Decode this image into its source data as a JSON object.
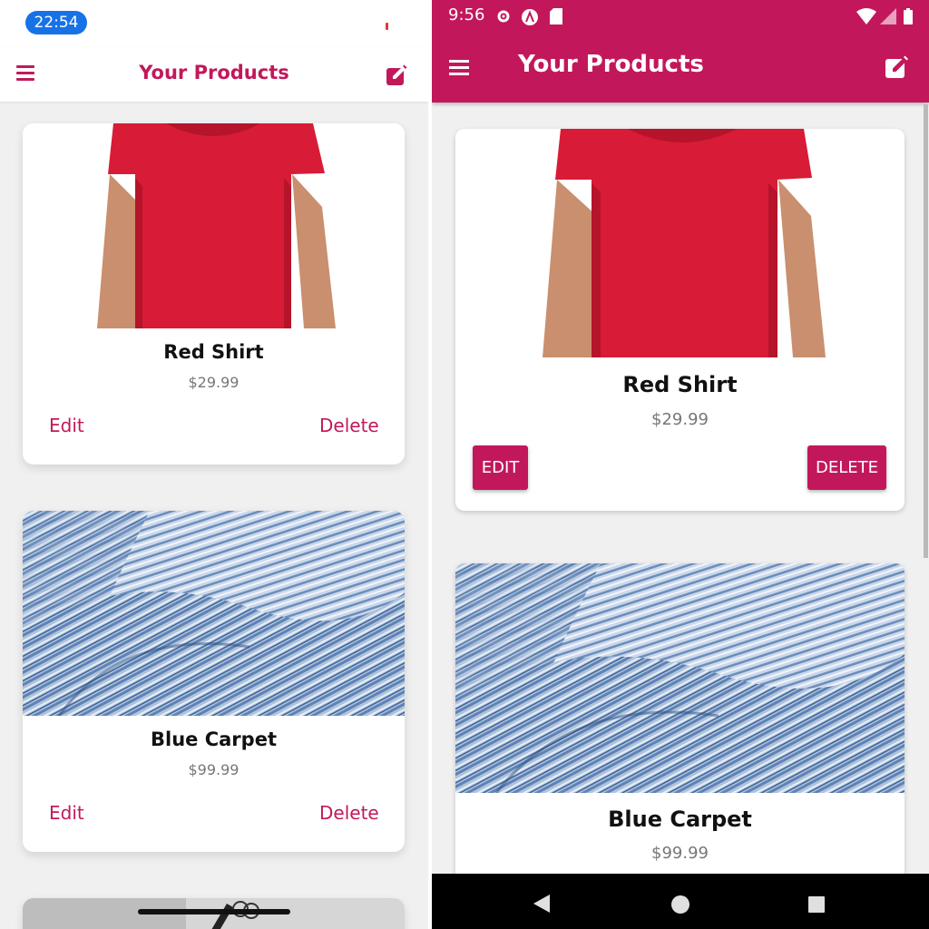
{
  "ios": {
    "status_time": "22:54",
    "title": "Your Products",
    "products": [
      {
        "name": "Red Shirt",
        "price": "$29.99",
        "edit_label": "Edit",
        "delete_label": "Delete",
        "image_icon": "red-tshirt-image"
      },
      {
        "name": "Blue Carpet",
        "price": "$99.99",
        "edit_label": "Edit",
        "delete_label": "Delete",
        "image_icon": "blue-fabric-image"
      }
    ]
  },
  "android": {
    "status_time": "9:56",
    "title": "Your Products",
    "products": [
      {
        "name": "Red Shirt",
        "price": "$29.99",
        "edit_label": "EDIT",
        "delete_label": "DELETE",
        "image_icon": "red-tshirt-image"
      },
      {
        "name": "Blue Carpet",
        "price": "$99.99",
        "image_icon": "blue-fabric-image"
      }
    ]
  },
  "colors": {
    "accent": "#c2185b",
    "ios_time_pill": "#1672e6",
    "shirt": "#d81b36",
    "fabric": "#9bb4d3"
  }
}
